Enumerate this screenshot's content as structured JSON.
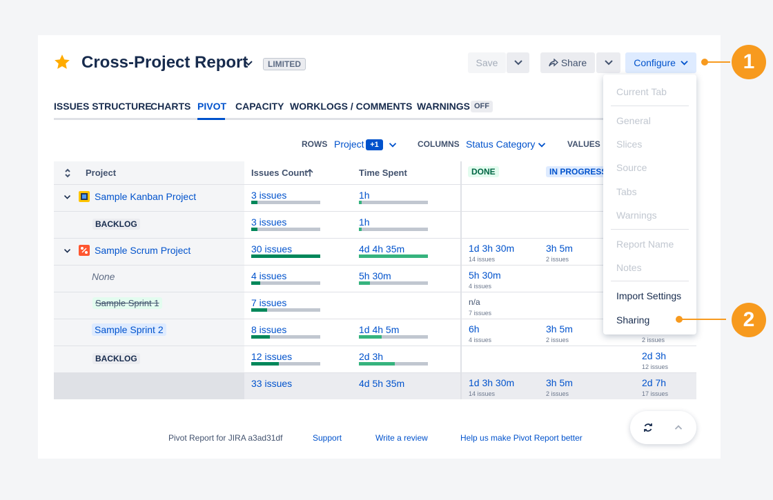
{
  "header": {
    "title": "Cross-Project Report",
    "badge": "LIMITED",
    "save": "Save",
    "share": "Share",
    "configure": "Configure"
  },
  "tabs": [
    {
      "label": "ISSUES STRUCTURE"
    },
    {
      "label": "CHARTS"
    },
    {
      "label": "PIVOT",
      "active": true
    },
    {
      "label": "CAPACITY"
    },
    {
      "label": "WORKLOGS / COMMENTS"
    },
    {
      "label": "WARNINGS",
      "badge": "OFF"
    }
  ],
  "config": {
    "rows_label": "ROWS",
    "rows_value": "Project",
    "rows_extra": "+1",
    "columns_label": "COLUMNS",
    "columns_value": "Status Category",
    "values_label": "VALUES"
  },
  "table": {
    "headers": {
      "project": "Project",
      "issues_count": "Issues Count",
      "time_spent": "Time Spent",
      "done": "DONE",
      "in_progress": "IN PROGRESS"
    },
    "rows": [
      {
        "name": "Sample Kanban Project",
        "issues": "3 issues",
        "time": "1h",
        "issues_fill": 0.09,
        "time_fill": 0.04
      },
      {
        "name": "BACKLOG",
        "issues": "3 issues",
        "time": "1h",
        "issues_fill": 0.09,
        "time_fill": 0.04
      },
      {
        "name": "Sample Scrum Project",
        "issues": "30 issues",
        "time": "4d 4h 35m",
        "issues_fill": 1.0,
        "time_fill": 1.0,
        "done": "1d 3h 30m",
        "done_sub": "14 issues",
        "inprog": "3h 5m",
        "inprog_sub": "2 issues"
      },
      {
        "name": "None",
        "issues": "4 issues",
        "time": "5h 30m",
        "issues_fill": 0.13,
        "time_fill": 0.16,
        "done": "5h 30m",
        "done_sub": "4 issues"
      },
      {
        "name": "Sample Sprint 1",
        "issues": "7 issues",
        "time": "",
        "issues_fill": 0.23,
        "done": "n/a",
        "done_sub": "7 issues"
      },
      {
        "name": "Sample Sprint 2",
        "issues": "8 issues",
        "time": "1d 4h 5m",
        "issues_fill": 0.27,
        "time_fill": 0.33,
        "done": "6h",
        "done_sub": "4 issues",
        "inprog": "3h 5m",
        "inprog_sub": "2 issues",
        "last_sub": "2 issues"
      },
      {
        "name": "BACKLOG",
        "issues": "12 issues",
        "time": "2d 3h",
        "issues_fill": 0.4,
        "time_fill": 0.52,
        "last": "2d 3h",
        "last_sub": "12 issues"
      }
    ],
    "total": {
      "issues": "33 issues",
      "time": "4d 5h 35m",
      "done": "1d 3h 30m",
      "done_sub": "14 issues",
      "inprog": "3h 5m",
      "inprog_sub": "2 issues",
      "last": "2d 7h",
      "last_sub": "17 issues"
    }
  },
  "menu": {
    "items": [
      "Current Tab",
      "General",
      "Slices",
      "Source",
      "Tabs",
      "Warnings",
      "Report Name",
      "Notes",
      "Import Settings",
      "Sharing"
    ]
  },
  "footer": {
    "version": "Pivot Report for JIRA a3ad31df",
    "support": "Support",
    "review": "Write a review",
    "help": "Help us make Pivot Report better"
  },
  "callouts": [
    "1",
    "2"
  ],
  "colors": {
    "accent": "#0052cc",
    "bar_dark": "#00875a",
    "bar_light": "#36b37e",
    "callout": "#f79a1e"
  }
}
